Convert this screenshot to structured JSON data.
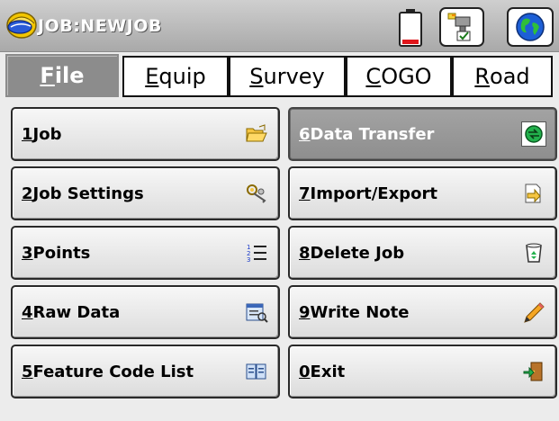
{
  "title_bar": {
    "job_title": "JOB:NEWJOB",
    "icons": [
      "surveyor-helmet-icon",
      "battery-icon",
      "instrument-status-icon",
      "globe-icon"
    ]
  },
  "menu": {
    "tabs": [
      {
        "mnemonic": "F",
        "rest": "ile",
        "active": true
      },
      {
        "mnemonic": "E",
        "rest": "quip",
        "active": false
      },
      {
        "mnemonic": "S",
        "rest": "urvey",
        "active": false
      },
      {
        "mnemonic": "C",
        "rest": "OGO",
        "active": false
      },
      {
        "mnemonic": "R",
        "rest": "oad",
        "active": false
      }
    ]
  },
  "buttons": [
    {
      "num": "1",
      "label": "Job",
      "icon": "open-folder-icon"
    },
    {
      "num": "2",
      "label": "Job Settings",
      "icon": "settings-keys-icon"
    },
    {
      "num": "3",
      "label": "Points",
      "icon": "numbered-list-icon"
    },
    {
      "num": "4",
      "label": "Raw Data",
      "icon": "raw-data-icon"
    },
    {
      "num": "5",
      "label": "Feature Code List",
      "icon": "book-icon"
    },
    {
      "num": "6",
      "label": "Data Transfer",
      "icon": "transfer-globe-icon",
      "selected": true
    },
    {
      "num": "7",
      "label": "Import/Export",
      "icon": "import-export-icon"
    },
    {
      "num": "8",
      "label": "Delete Job",
      "icon": "recycle-bin-icon"
    },
    {
      "num": "9",
      "label": "Write Note",
      "icon": "pencil-icon"
    },
    {
      "num": "0",
      "label": "Exit",
      "icon": "exit-door-icon"
    }
  ],
  "colors": {
    "active_tab_bg": "#8c8c8c",
    "selected_button_bg": "#999999",
    "title_bar_bg": "#bdbdbd",
    "accent_green": "#22b14c"
  }
}
